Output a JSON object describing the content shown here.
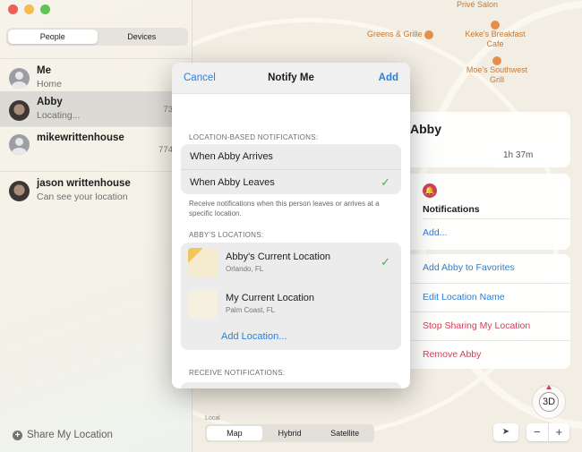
{
  "sidebar": {
    "tabs": [
      "People",
      "Devices"
    ],
    "people": [
      {
        "name": "Me",
        "sub": "Home",
        "dist": ""
      },
      {
        "name": "Abby",
        "sub": "Locating...",
        "dist": "73"
      },
      {
        "name": "mikewrittenhouse",
        "sub": "",
        "dist": "774"
      },
      {
        "name": "jason writtenhouse",
        "sub": "Can see your location",
        "dist": ""
      }
    ],
    "share_label": "Share My Location"
  },
  "map": {
    "pois": [
      "Privé Salon",
      "Greens & Grille",
      "Keke's Breakfast Cafe",
      "Moe's Southwest Grill"
    ],
    "road_label": "Local",
    "modes": [
      "Map",
      "Hybrid",
      "Satellite"
    ],
    "selected_mode": "Map",
    "compass_label": "3D",
    "zoom_out": "−",
    "zoom_in": "+"
  },
  "modal": {
    "cancel": "Cancel",
    "title": "Notify Me",
    "add": "Add",
    "location_section": "LOCATION-BASED NOTIFICATIONS:",
    "options": [
      {
        "label": "When Abby Arrives",
        "checked": false
      },
      {
        "label": "When Abby Leaves",
        "checked": true
      }
    ],
    "note": "Receive notifications when this person leaves or arrives at a specific location.",
    "locations_section": "ABBY'S LOCATIONS:",
    "locations": [
      {
        "name": "Abby's Current Location",
        "sub": "Orlando, FL",
        "checked": true
      },
      {
        "name": "My Current Location",
        "sub": "Palm Coast, FL",
        "checked": false
      }
    ],
    "add_location": "Add Location...",
    "receive_section": "RECEIVE NOTIFICATIONS:",
    "check": "✓"
  },
  "card": {
    "name": "Abby",
    "eta": "1h 37m",
    "notifications_title": "Notifications",
    "notifications_add": "Add...",
    "actions": [
      {
        "label": "Add Abby to Favorites",
        "color": "#2c7fd5"
      },
      {
        "label": "Edit Location Name",
        "color": "#2c7fd5"
      },
      {
        "label": "Stop Sharing My Location",
        "color": "#d0405a"
      },
      {
        "label": "Remove Abby",
        "color": "#d0405a"
      }
    ]
  },
  "colors": {
    "accent": "#2c7fd5",
    "destructive": "#d0405a",
    "check": "#4bb34b"
  }
}
